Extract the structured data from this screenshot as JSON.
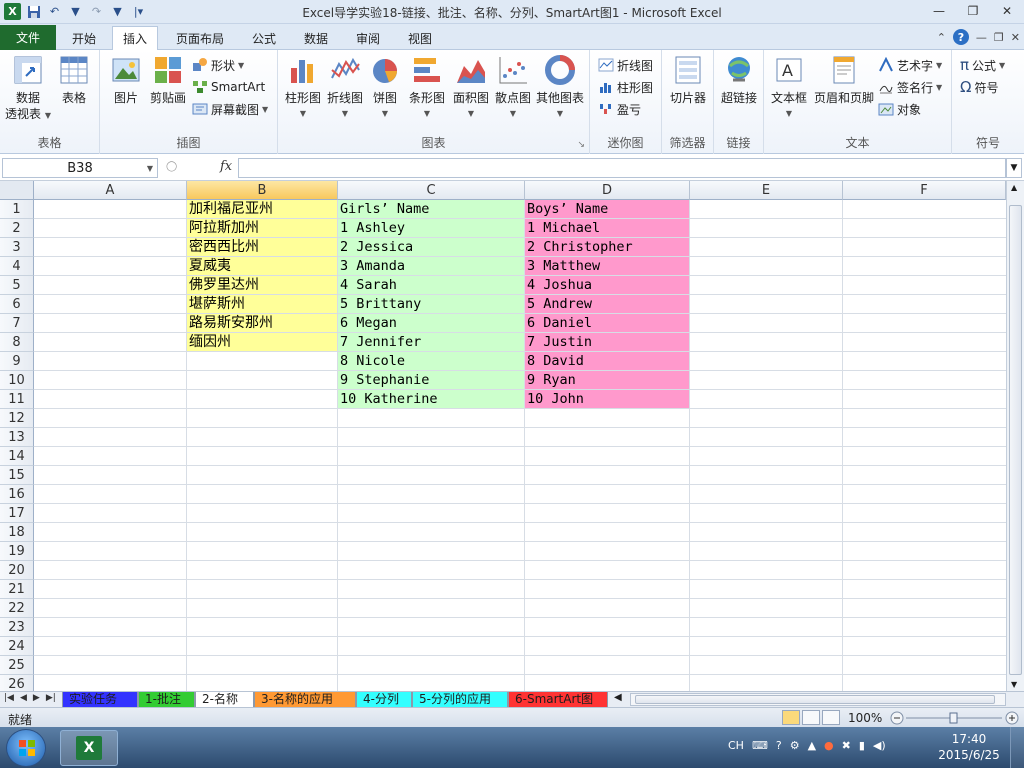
{
  "window": {
    "title": "Excel导学实验18-链接、批注、名称、分列、SmartArt图1 - Microsoft Excel"
  },
  "tabs": [
    {
      "label": "文件"
    },
    {
      "label": "开始"
    },
    {
      "label": "插入"
    },
    {
      "label": "页面布局"
    },
    {
      "label": "公式"
    },
    {
      "label": "数据"
    },
    {
      "label": "审阅"
    },
    {
      "label": "视图"
    }
  ],
  "ribbon": {
    "groups": {
      "table": "表格",
      "illustrations": "插图",
      "charts": "图表",
      "sparklines": "迷你图",
      "filter": "筛选器",
      "links": "链接",
      "text": "文本",
      "symbols": "符号"
    },
    "buttons": {
      "pivot_line1": "数据",
      "pivot_line2": "透视表",
      "table": "表格",
      "picture": "图片",
      "clipart": "剪贴画",
      "shapes": "形状",
      "smartart": "SmartArt",
      "screenshot": "屏幕截图",
      "column_chart": "柱形图",
      "line_chart": "折线图",
      "pie_chart": "饼图",
      "bar_chart": "条形图",
      "area_chart": "面积图",
      "scatter_chart": "散点图",
      "other_chart": "其他图表",
      "spark_line": "折线图",
      "spark_column": "柱形图",
      "spark_winloss": "盈亏",
      "slicer": "切片器",
      "hyperlink": "超链接",
      "textbox": "文本框",
      "header_footer": "页眉和页脚",
      "wordart": "艺术字",
      "signature": "签名行",
      "object": "对象",
      "equation": "公式",
      "symbol": "符号"
    }
  },
  "formula_bar": {
    "name_box": "B38",
    "fx": "fx",
    "value": ""
  },
  "columns": [
    "A",
    "B",
    "C",
    "D",
    "E",
    "F"
  ],
  "rows": [
    "1",
    "2",
    "3",
    "4",
    "5",
    "6",
    "7",
    "8",
    "9",
    "10",
    "11",
    "12",
    "13",
    "14",
    "15",
    "16",
    "17",
    "18",
    "19",
    "20",
    "21",
    "22",
    "23",
    "24",
    "25",
    "26"
  ],
  "cells": {
    "B": [
      "加利福尼亚州",
      "阿拉斯加州",
      "密西西比州",
      "夏威夷",
      "佛罗里达州",
      "堪萨斯州",
      "路易斯安那州",
      "缅因州"
    ],
    "C": [
      "Girls’ Name",
      "1 Ashley",
      "2 Jessica",
      "3 Amanda",
      "4 Sarah",
      "5 Brittany",
      "6 Megan",
      "7 Jennifer",
      "8 Nicole",
      "9 Stephanie",
      "10 Katherine"
    ],
    "D": [
      "Boys’ Name",
      "1 Michael",
      "2 Christopher",
      "3 Matthew",
      "4 Joshua",
      "5 Andrew",
      "6 Daniel",
      "7 Justin",
      "8 David",
      "9 Ryan",
      "10 John"
    ]
  },
  "colors": {
    "col_b_fill": "#ffff99",
    "col_c_fill": "#ccffcc",
    "col_d_fill": "#ff99cc"
  },
  "sheets": [
    {
      "label": "实验任务",
      "color": "#3333ff"
    },
    {
      "label": "1-批注",
      "color": "#33cc33"
    },
    {
      "label": "2-名称",
      "color": "#ffffff"
    },
    {
      "label": "3-名称的应用",
      "color": "#ff9933"
    },
    {
      "label": "4-分列",
      "color": "#33ffff"
    },
    {
      "label": "5-分列的应用",
      "color": "#33ffff"
    },
    {
      "label": "6-SmartArt图",
      "color": "#ff3333"
    }
  ],
  "status": {
    "ready": "就绪",
    "zoom": "100%"
  },
  "taskbar": {
    "ime": "CH",
    "time": "17:40",
    "date": "2015/6/25"
  }
}
